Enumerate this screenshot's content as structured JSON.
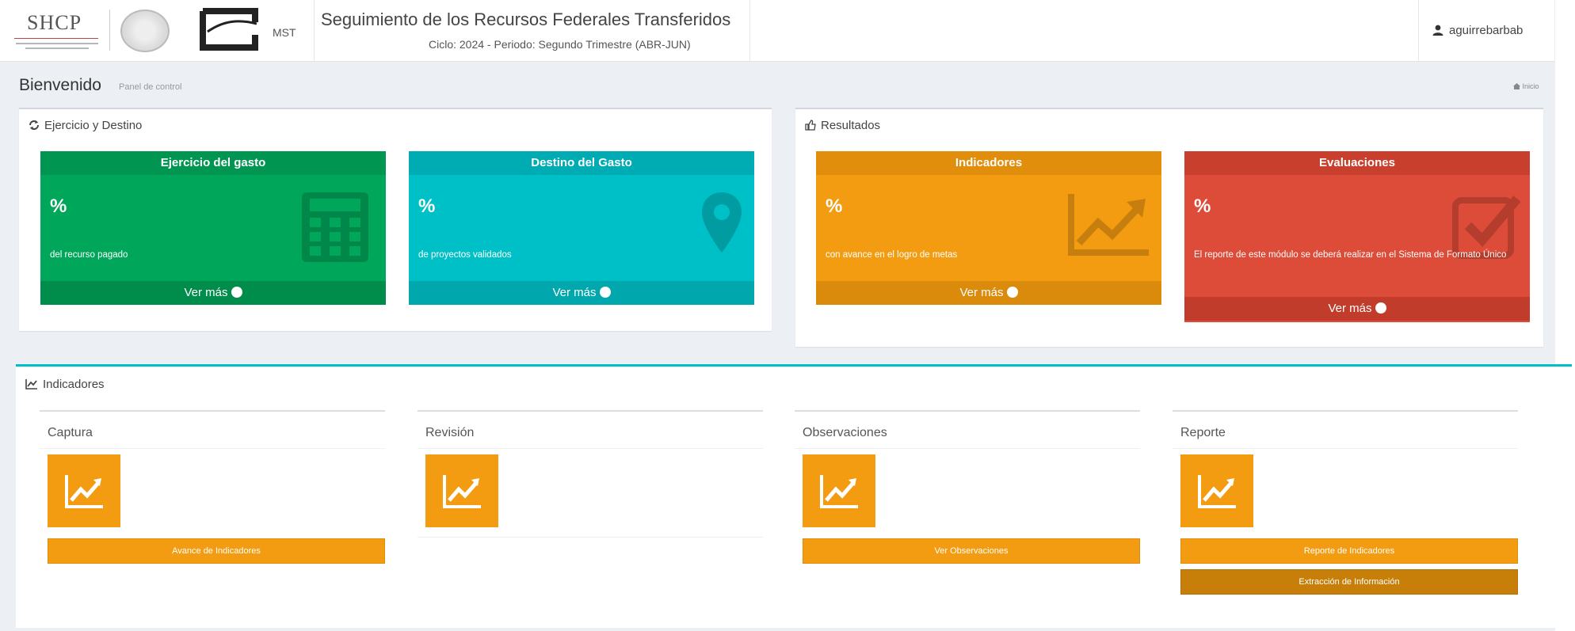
{
  "header": {
    "shcp_logo_text": "SHCP",
    "mst_text": "MST",
    "title": "Seguimiento de los Recursos Federales Transferidos",
    "subtitle": "Ciclo: 2024 - Periodo: Segundo Trimestre (ABR-JUN)",
    "user": "aguirrebarbab"
  },
  "page": {
    "heading": "Bienvenido",
    "subheading": "Panel de control",
    "breadcrumb": "Inicio"
  },
  "ejercicio_panel": {
    "title": "Ejercicio y Destino",
    "tiles": [
      {
        "title": "Ejercicio del gasto",
        "percent": "%",
        "desc": "del recurso pagado",
        "link": "Ver más",
        "color": "#00a65a",
        "icon": "calculator-icon"
      },
      {
        "title": "Destino del Gasto",
        "percent": "%",
        "desc": "de proyectos validados",
        "link": "Ver más",
        "color": "#00c0c7",
        "icon": "map-marker-icon"
      }
    ]
  },
  "resultados_panel": {
    "title": "Resultados",
    "tiles": [
      {
        "title": "Indicadores",
        "percent": "%",
        "desc": "con avance en el logro de metas",
        "link": "Ver más",
        "color": "#f39c12",
        "icon": "line-chart-icon"
      },
      {
        "title": "Evaluaciones",
        "percent": "%",
        "desc": "El reporte de este módulo se deberá realizar en el Sistema de Formato Único",
        "link": "Ver más",
        "color": "#dd4b39",
        "icon": "check-square-icon"
      }
    ]
  },
  "indicadores_panel": {
    "title": "Indicadores",
    "columns": [
      {
        "title": "Captura",
        "buttons": [
          "Avance de Indicadores"
        ]
      },
      {
        "title": "Revisión",
        "buttons": []
      },
      {
        "title": "Observaciones",
        "buttons": [
          "Ver Observaciones"
        ]
      },
      {
        "title": "Reporte",
        "buttons": [
          "Reporte de Indicadores",
          "Extracción de Información"
        ]
      }
    ]
  }
}
